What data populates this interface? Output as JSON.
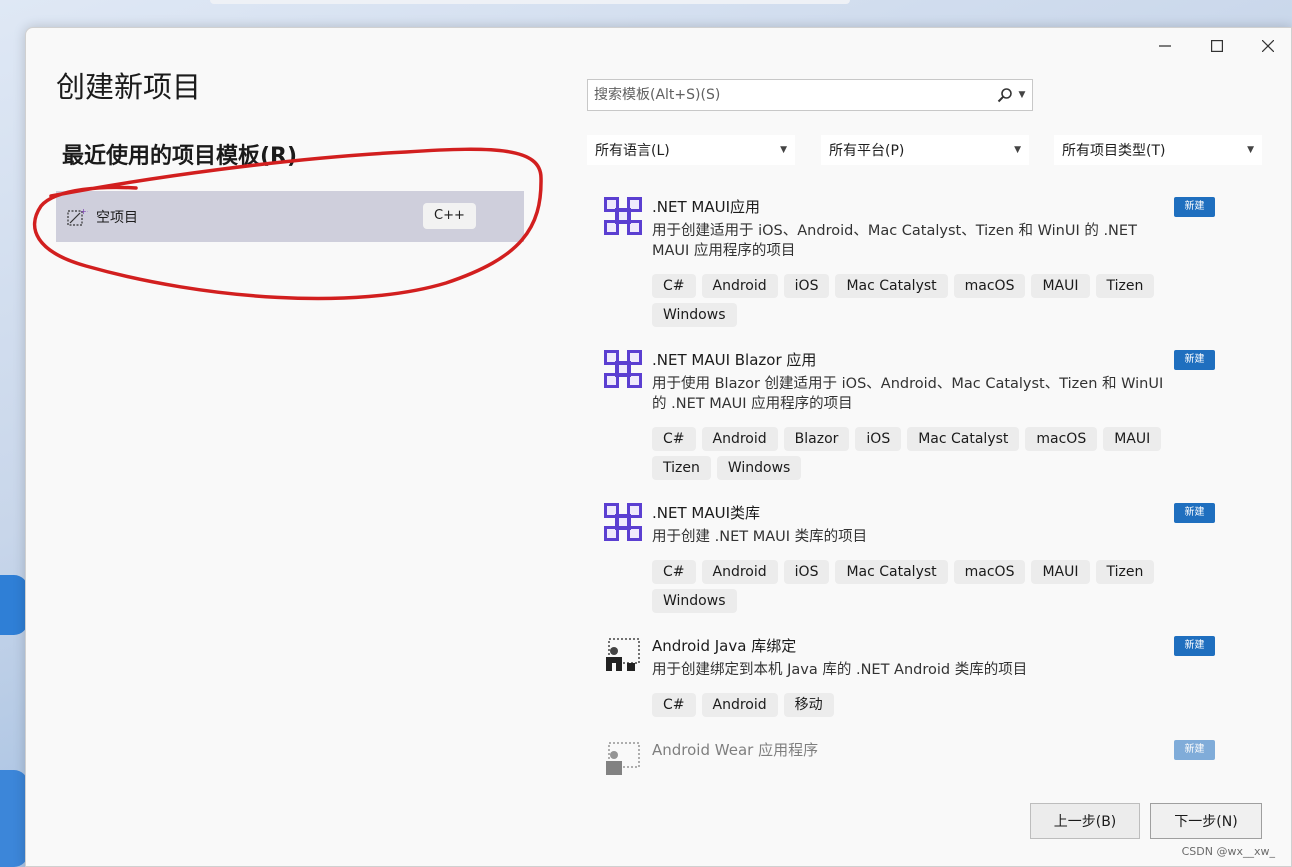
{
  "window": {
    "title": "创建新项目",
    "controls": {
      "minimize": "minimize-icon",
      "maximize": "maximize-icon",
      "close": "close-icon"
    }
  },
  "recent": {
    "heading": "最近使用的项目模板(R)",
    "items": [
      {
        "name": "空项目",
        "language": "C++",
        "icon": "empty-project-icon"
      }
    ]
  },
  "search": {
    "placeholder": "搜索模板(Alt+S)(S)",
    "value": "",
    "icon": "search-icon"
  },
  "filters": {
    "language": "所有语言(L)",
    "platform": "所有平台(P)",
    "project_type": "所有项目类型(T)"
  },
  "templates": [
    {
      "name": ".NET MAUI应用",
      "description": "用于创建适用于 iOS、Android、Mac Catalyst、Tizen 和 WinUI 的 .NET MAUI 应用程序的项目",
      "badge": "新建",
      "icon": "maui-icon",
      "tags": [
        "C#",
        "Android",
        "iOS",
        "Mac Catalyst",
        "macOS",
        "MAUI",
        "Tizen",
        "Windows"
      ]
    },
    {
      "name": ".NET MAUI Blazor 应用",
      "description": "用于使用 Blazor 创建适用于 iOS、Android、Mac Catalyst、Tizen 和 WinUI 的 .NET MAUI 应用程序的项目",
      "badge": "新建",
      "icon": "maui-icon",
      "tags": [
        "C#",
        "Android",
        "Blazor",
        "iOS",
        "Mac Catalyst",
        "macOS",
        "MAUI",
        "Tizen",
        "Windows"
      ]
    },
    {
      "name": ".NET MAUI类库",
      "description": "用于创建 .NET MAUI 类库的项目",
      "badge": "新建",
      "icon": "maui-icon",
      "tags": [
        "C#",
        "Android",
        "iOS",
        "Mac Catalyst",
        "macOS",
        "MAUI",
        "Tizen",
        "Windows"
      ]
    },
    {
      "name": "Android Java 库绑定",
      "description": "用于创建绑定到本机 Java 库的 .NET Android 类库的项目",
      "badge": "新建",
      "icon": "android-binding-icon",
      "tags": [
        "C#",
        "Android",
        "移动"
      ]
    },
    {
      "name": "Android Wear 应用程序",
      "description": "",
      "badge": "新建",
      "icon": "android-wear-icon",
      "tags": []
    }
  ],
  "buttons": {
    "back": "上一步(B)",
    "next": "下一步(N)"
  },
  "watermark": "CSDN @wx__xw_",
  "colors": {
    "badge": "#1f6fbf",
    "selection": "#cfcfdc",
    "annotation": "#d21f1f",
    "maui_icon": "#5b3fd1"
  }
}
